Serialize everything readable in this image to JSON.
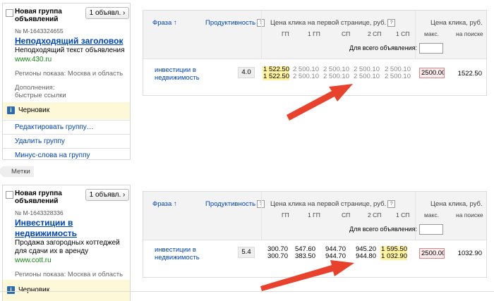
{
  "groups": [
    {
      "title": "Новая группа объявлений",
      "ads_button": "1 объявл. ›",
      "ad_number": "№ М-1643324655",
      "ad_title": "Неподходящий заголовок",
      "ad_text": "Неподходящий текст объявления",
      "ad_url": "www.430.ru",
      "regions": "Регионы показа: Москва и область",
      "extras_label": "Дополнения:",
      "extras_value": "быстрые ссылки",
      "status": "Черновик",
      "menu": [
        "Редактировать группу…",
        "Удалить группу",
        "Минус-слова на группу"
      ]
    },
    {
      "title": "Новая группа объявлений",
      "ads_button": "1 объявл. ›",
      "ad_number": "№ М-1643328336",
      "ad_title": "Инвестиции в недвижимость",
      "ad_text": "Продажа загородных коттеджей для сдачи их в аренду",
      "ad_url": "www.cott.ru",
      "regions": "Регионы показа: Москва и область",
      "status": "Черновик"
    }
  ],
  "labels_tag": "Метки",
  "table_header": {
    "phrase": "Фраза ↑",
    "productivity": "Продуктивность",
    "first_page_price": "Цена клика на первой странице, руб.",
    "click_price": "Цена клика, руб.",
    "columns": [
      "ГП",
      "1 ГП",
      "СП",
      "2 СП",
      "1 СП"
    ],
    "max_label": "макс.",
    "search_label": "на поиске",
    "all_ads_label": "Для всего объявления:",
    "help_glyph": "?"
  },
  "rows": [
    {
      "phrase_line1": "инвестиции в",
      "phrase_line2": "недвижимость",
      "productivity": "4.0",
      "top": [
        "1 522.50",
        "2 500.10",
        "2 500.10",
        "2 500.10",
        "2 500.10"
      ],
      "bottom": [
        "1 522.50",
        "2 500.10",
        "2 500.10",
        "2 500.10",
        "2 500.10"
      ],
      "max_value": "2500.00",
      "search_value": "1522.50"
    },
    {
      "phrase_line1": "инвестиции в",
      "phrase_line2": "недвижимость",
      "productivity": "5.4",
      "top": [
        "300.70",
        "547.60",
        "944.70",
        "945.20",
        "1 595.50"
      ],
      "bottom": [
        "300.70",
        "383.50",
        "944.70",
        "944.80",
        "1 032.90"
      ],
      "max_value": "2500.00",
      "search_value": "1032.90"
    }
  ],
  "colors": {
    "link": "#0044bb",
    "url": "#118811",
    "highlight": "#fff2a0",
    "arrow": "#e8412c",
    "draft_bg": "#fdf8d8"
  }
}
